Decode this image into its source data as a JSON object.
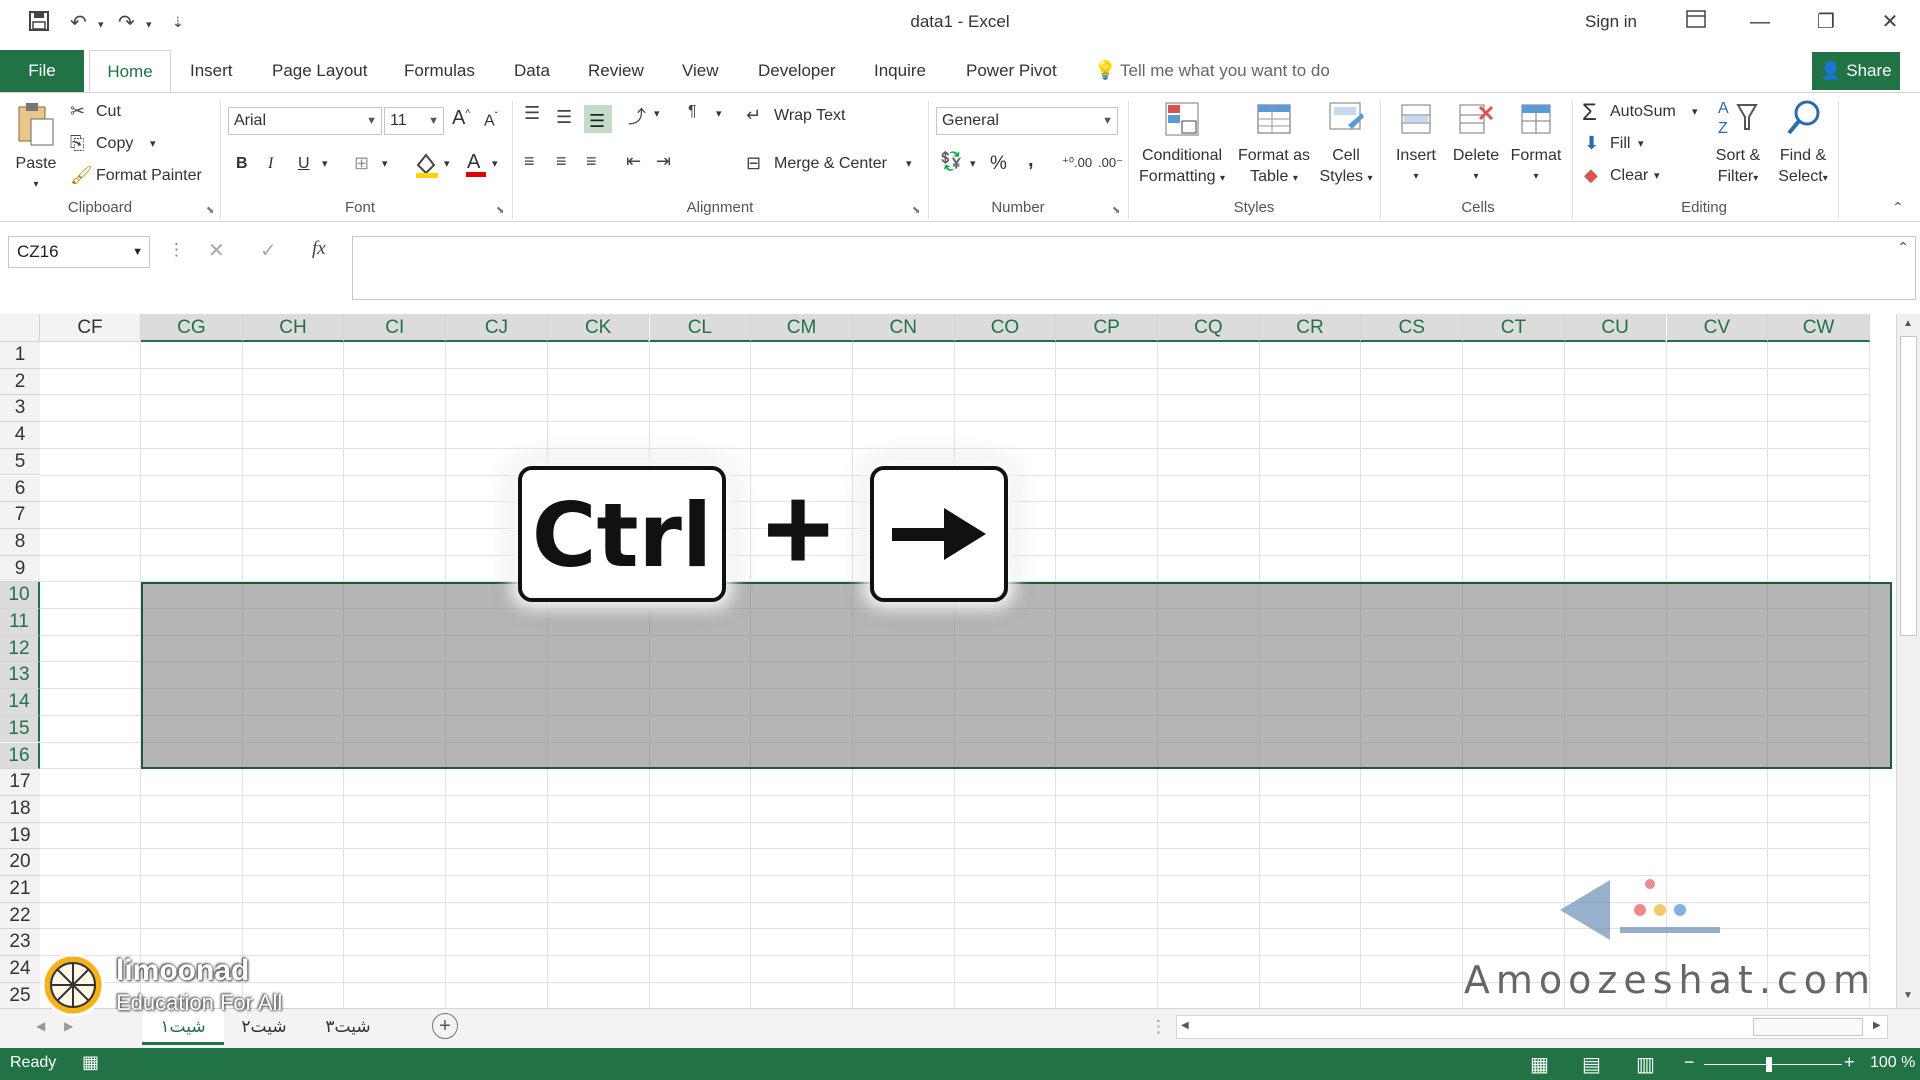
{
  "window": {
    "title": "data1  -  Excel",
    "signin": "Sign in"
  },
  "tabs": [
    "File",
    "Home",
    "Insert",
    "Page Layout",
    "Formulas",
    "Data",
    "Review",
    "View",
    "Developer",
    "Inquire",
    "Power Pivot"
  ],
  "tellme": "Tell me what you want to do",
  "share": "Share",
  "clipboard": {
    "paste": "Paste",
    "cut": "Cut",
    "copy": "Copy",
    "format_painter": "Format Painter",
    "label": "Clipboard"
  },
  "font": {
    "name": "Arial",
    "size": "11",
    "bold": "B",
    "italic": "I",
    "underline": "U",
    "label": "Font"
  },
  "alignment": {
    "wrap_text": "Wrap Text",
    "merge_center": "Merge & Center",
    "label": "Alignment"
  },
  "number": {
    "format": "General",
    "percent": "%",
    "comma": ",",
    "label": "Number"
  },
  "styles": {
    "conditional_1": "Conditional",
    "conditional_2": "Formatting",
    "format_table_1": "Format as",
    "format_table_2": "Table",
    "cell_styles_1": "Cell",
    "cell_styles_2": "Styles",
    "label": "Styles"
  },
  "cells": {
    "insert": "Insert",
    "delete": "Delete",
    "format": "Format",
    "label": "Cells"
  },
  "editing": {
    "autosum": "AutoSum",
    "fill": "Fill",
    "clear": "Clear",
    "sort_1": "Sort &",
    "sort_2": "Filter",
    "find_1": "Find &",
    "find_2": "Select",
    "label": "Editing"
  },
  "formula_bar": {
    "name_box": "CZ16",
    "fx": "fx"
  },
  "columns": [
    "CF",
    "CG",
    "CH",
    "CI",
    "CJ",
    "CK",
    "CL",
    "CM",
    "CN",
    "CO",
    "CP",
    "CQ",
    "CR",
    "CS",
    "CT",
    "CU",
    "CV",
    "CW"
  ],
  "rows": [
    "1",
    "2",
    "3",
    "4",
    "5",
    "6",
    "7",
    "8",
    "9",
    "10",
    "11",
    "12",
    "13",
    "14",
    "15",
    "16",
    "17",
    "18",
    "19",
    "20",
    "21",
    "22",
    "23",
    "24",
    "25"
  ],
  "selection": {
    "first_col": "CG",
    "first_row": "10",
    "last_row": "16"
  },
  "overlay": {
    "ctrl": "Ctrl",
    "plus": "+",
    "arrow": "→"
  },
  "sheets": [
    "شیت۱",
    "شیت۲",
    "شیت۳"
  ],
  "status": {
    "ready": "Ready",
    "zoom": "100 %"
  },
  "watermarks": {
    "limoonad_1": "limoonad",
    "limoonad_2": "Education For All",
    "amoozeshat": "Amoozeshat.com"
  },
  "colors": {
    "accent": "#217346",
    "selection_fill": "#9a9a9a"
  }
}
